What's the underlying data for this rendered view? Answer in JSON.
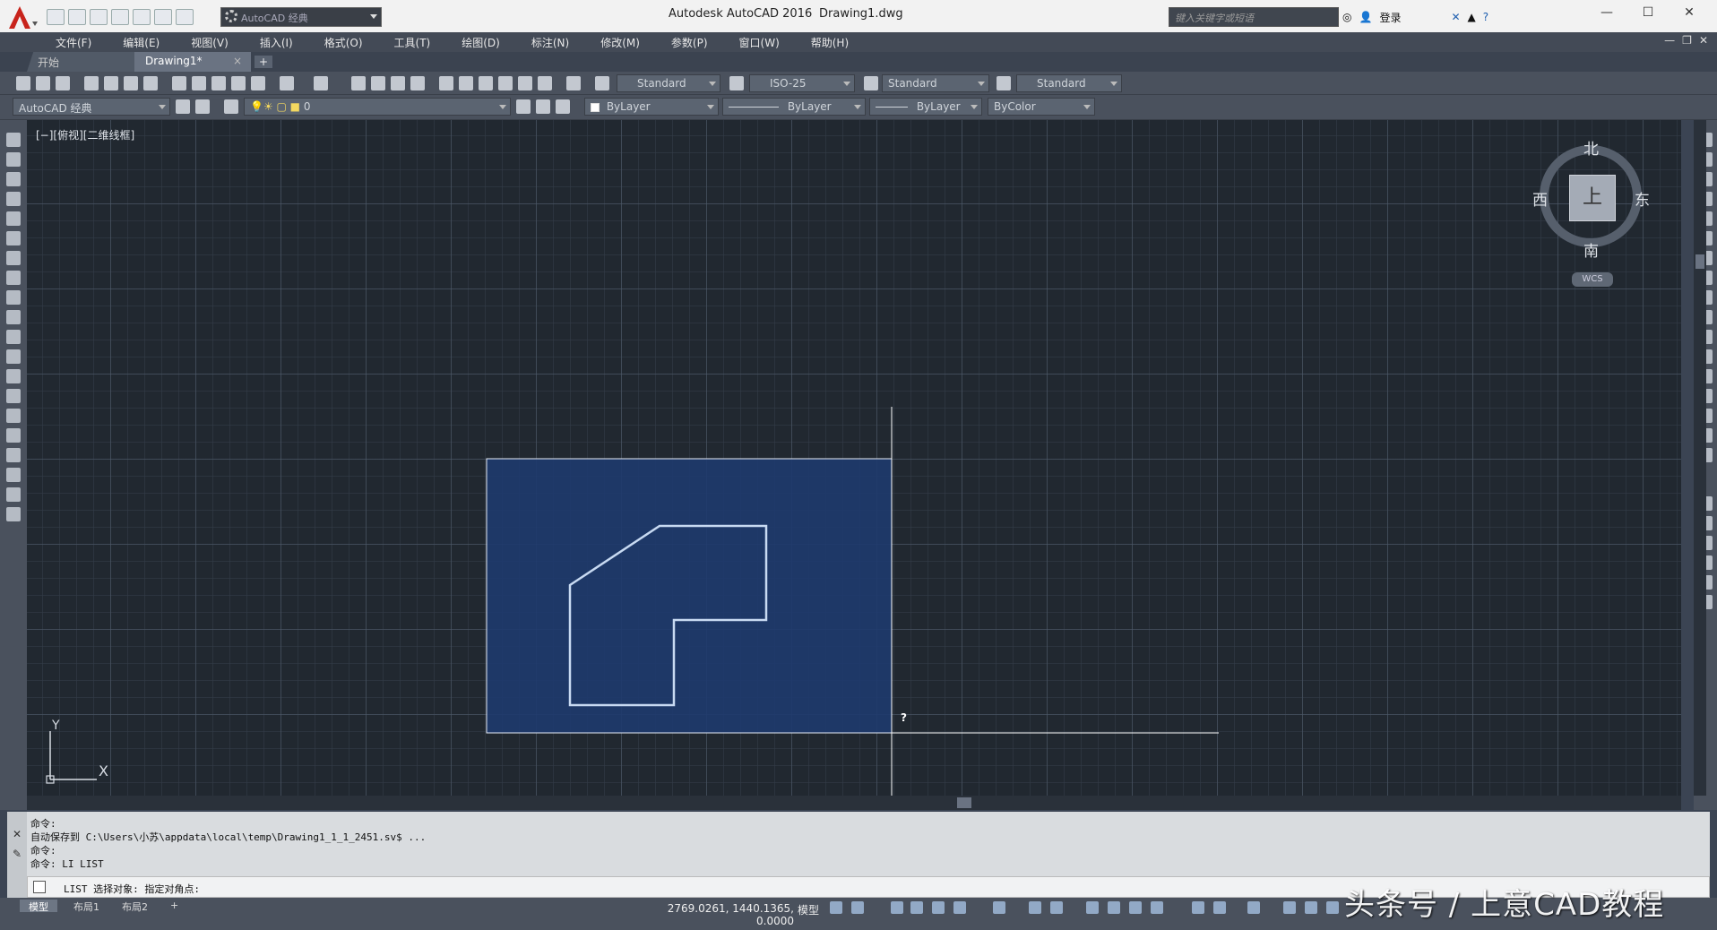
{
  "title": {
    "app": "Autodesk AutoCAD 2016",
    "file": "Drawing1.dwg",
    "workspace": "AutoCAD 经典",
    "search_placeholder": "键入关键字或短语",
    "login": "登录"
  },
  "menu": [
    "文件(F)",
    "编辑(E)",
    "视图(V)",
    "插入(I)",
    "格式(O)",
    "工具(T)",
    "绘图(D)",
    "标注(N)",
    "修改(M)",
    "参数(P)",
    "窗口(W)",
    "帮助(H)"
  ],
  "tabs": {
    "start": "开始",
    "drawing": "Drawing1*",
    "close": "×",
    "add": "+"
  },
  "toolbar1": {
    "text_style": "Standard",
    "dim_style": "ISO-25",
    "table_style": "Standard",
    "mleader_style": "Standard"
  },
  "toolbar2": {
    "workspace": "AutoCAD 经典",
    "layer": "0",
    "color": "ByLayer",
    "linetype": "ByLayer",
    "lineweight": "ByLayer",
    "plotstyle": "ByColor"
  },
  "viewport": {
    "label": "[−][俯视][二维线框]"
  },
  "viewcube": {
    "north": "北",
    "south": "南",
    "east": "东",
    "west": "西",
    "top": "上",
    "wcs": "WCS"
  },
  "ucs": {
    "x": "X",
    "y": "Y"
  },
  "cursor_hint": "?",
  "command": {
    "history": [
      "命令:",
      "自动保存到 C:\\Users\\小苏\\appdata\\local\\temp\\Drawing1_1_1_2451.sv$ ...",
      "命令:",
      "命令: LI LIST"
    ],
    "current": "LIST 选择对象: 指定对角点:"
  },
  "status": {
    "layouts": [
      "模型",
      "布局1",
      "布局2"
    ],
    "add_layout": "+",
    "coords": "2769.0261, 1440.1365, 0.0000",
    "model": "模型"
  },
  "watermark": "头条号 / 上意CAD教程",
  "colors": {
    "canvas": "#212830",
    "selection_fill": "#1e3a6e",
    "selection_border": "#e8eef8",
    "shape_stroke": "#c8daf2",
    "panel": "#4a515d"
  }
}
